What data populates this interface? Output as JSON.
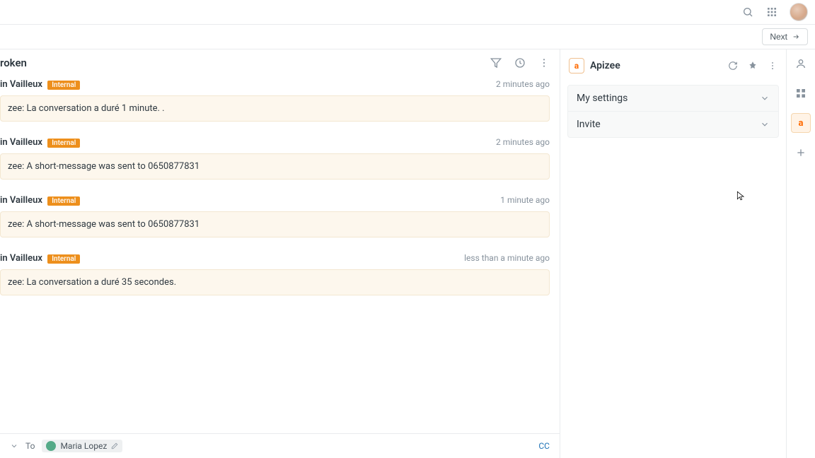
{
  "topbar": {},
  "next_button_label": "Next",
  "ticket": {
    "title": "roken"
  },
  "messages": [
    {
      "author": "in Vailleux",
      "badge": "Internal",
      "time": "2 minutes ago",
      "body": "zee: La conversation a duré 1 minute. ."
    },
    {
      "author": "in Vailleux",
      "badge": "Internal",
      "time": "2 minutes ago",
      "body": "zee: A short-message was sent to 0650877831"
    },
    {
      "author": "in Vailleux",
      "badge": "Internal",
      "time": "1 minute ago",
      "body": "zee: A short-message was sent to 0650877831"
    },
    {
      "author": "in Vailleux",
      "badge": "Internal",
      "time": "less than a minute ago",
      "body": "zee: La conversation a duré 35 secondes."
    }
  ],
  "reply": {
    "to_label": "To",
    "recipient": "Maria Lopez",
    "cc_label": "CC"
  },
  "panel": {
    "brand_name": "Apizee",
    "brand_logo_text": "a",
    "sections": [
      {
        "label": "My settings"
      },
      {
        "label": "Invite"
      }
    ]
  }
}
